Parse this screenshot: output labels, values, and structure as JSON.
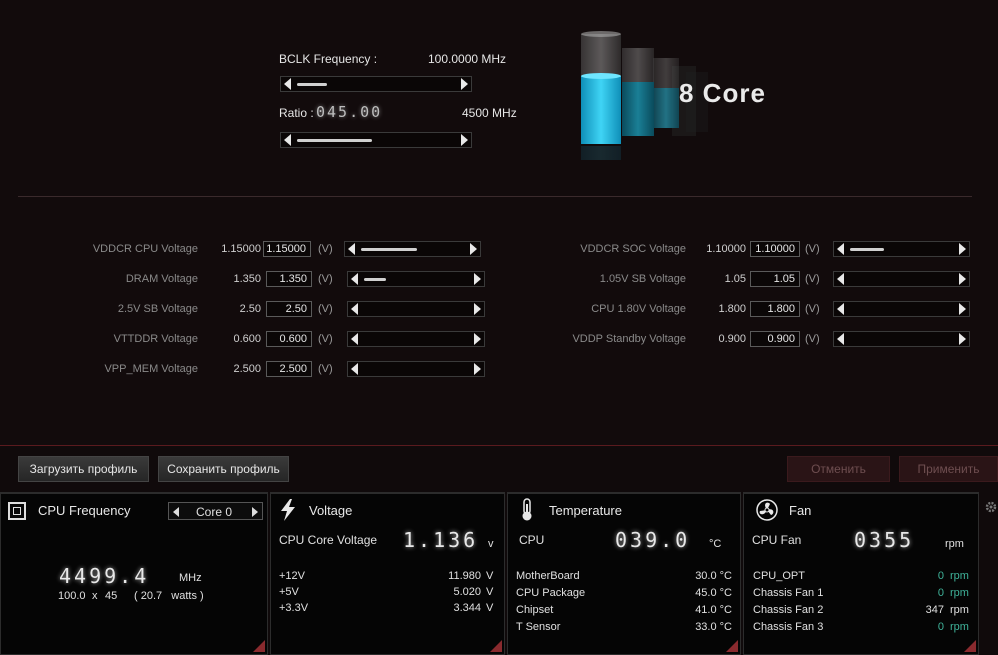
{
  "top": {
    "bclk_label": "BCLK Frequency :",
    "bclk_value": "100.0000 MHz",
    "ratio_label": "Ratio :",
    "ratio_value": "045.00",
    "ratio_mhz": "4500 MHz",
    "core_label": "8 Core",
    "bclk_slider_level": 0.15,
    "ratio_slider_level": 0.45
  },
  "voltages_left": [
    {
      "label": "VDDCR CPU Voltage",
      "value": "1.15000",
      "input": "1.15000",
      "unit": "(V)"
    },
    {
      "label": "DRAM Voltage",
      "value": "1.350",
      "input": "1.350",
      "unit": "(V)"
    },
    {
      "label": "2.5V SB Voltage",
      "value": "2.50",
      "input": "2.50",
      "unit": "(V)"
    },
    {
      "label": "VTTDDR Voltage",
      "value": "0.600",
      "input": "0.600",
      "unit": "(V)"
    },
    {
      "label": "VPP_MEM Voltage",
      "value": "2.500",
      "input": "2.500",
      "unit": "(V)"
    }
  ],
  "voltages_right": [
    {
      "label": "VDDCR SOC Voltage",
      "value": "1.10000",
      "input": "1.10000",
      "unit": "(V)"
    },
    {
      "label": "1.05V SB Voltage",
      "value": "1.05",
      "input": "1.05",
      "unit": "(V)"
    },
    {
      "label": "CPU 1.80V Voltage",
      "value": "1.800",
      "input": "1.800",
      "unit": "(V)"
    },
    {
      "label": "VDDP Standby Voltage",
      "value": "0.900",
      "input": "0.900",
      "unit": "(V)"
    }
  ],
  "buttons": {
    "load_profile": "Загрузить профиль",
    "save_profile": "Сохранить профиль",
    "cancel": "Отменить",
    "apply": "Применить"
  },
  "cpu_panel": {
    "title": "CPU Frequency",
    "core_select": "Core 0",
    "freq": "4499.4",
    "freq_unit": "MHz",
    "bclk": "100.0",
    "x": "x",
    "mult": "45",
    "watts": "( 20.7   watts )"
  },
  "voltage_panel": {
    "title": "Voltage",
    "core_label": "CPU Core Voltage",
    "core_value": "1.136",
    "core_unit": "v",
    "rows": [
      {
        "label": "+12V",
        "value": "11.980",
        "unit": "V"
      },
      {
        "label": "+5V",
        "value": "5.020",
        "unit": "V"
      },
      {
        "label": "+3.3V",
        "value": "3.344",
        "unit": "V"
      }
    ]
  },
  "temp_panel": {
    "title": "Temperature",
    "main_label": "CPU",
    "main_value": "039.0",
    "main_unit": "°C",
    "rows": [
      {
        "label": "MotherBoard",
        "value": "30.0 °C"
      },
      {
        "label": "CPU Package",
        "value": "45.0 °C"
      },
      {
        "label": "Chipset",
        "value": "41.0 °C"
      },
      {
        "label": "T Sensor",
        "value": "33.0 °C"
      }
    ]
  },
  "fan_panel": {
    "title": "Fan",
    "main_label": "CPU Fan",
    "main_value": "0355",
    "main_unit": "rpm",
    "rows": [
      {
        "label": "CPU_OPT",
        "value": "0",
        "unit": "rpm"
      },
      {
        "label": "Chassis Fan 1",
        "value": "0",
        "unit": "rpm"
      },
      {
        "label": "Chassis Fan 2",
        "value": "347",
        "unit": "rpm"
      },
      {
        "label": "Chassis Fan 3",
        "value": "0",
        "unit": "rpm"
      }
    ]
  },
  "colors": {
    "accent_red": "#8a2a2e",
    "liquid_cyan": "#19b7e0",
    "fan_zero_green": "#3fb39a"
  },
  "icons": [
    "cpu-chip-icon",
    "lightning-icon",
    "thermometer-icon",
    "fan-icon",
    "gear-icon"
  ]
}
